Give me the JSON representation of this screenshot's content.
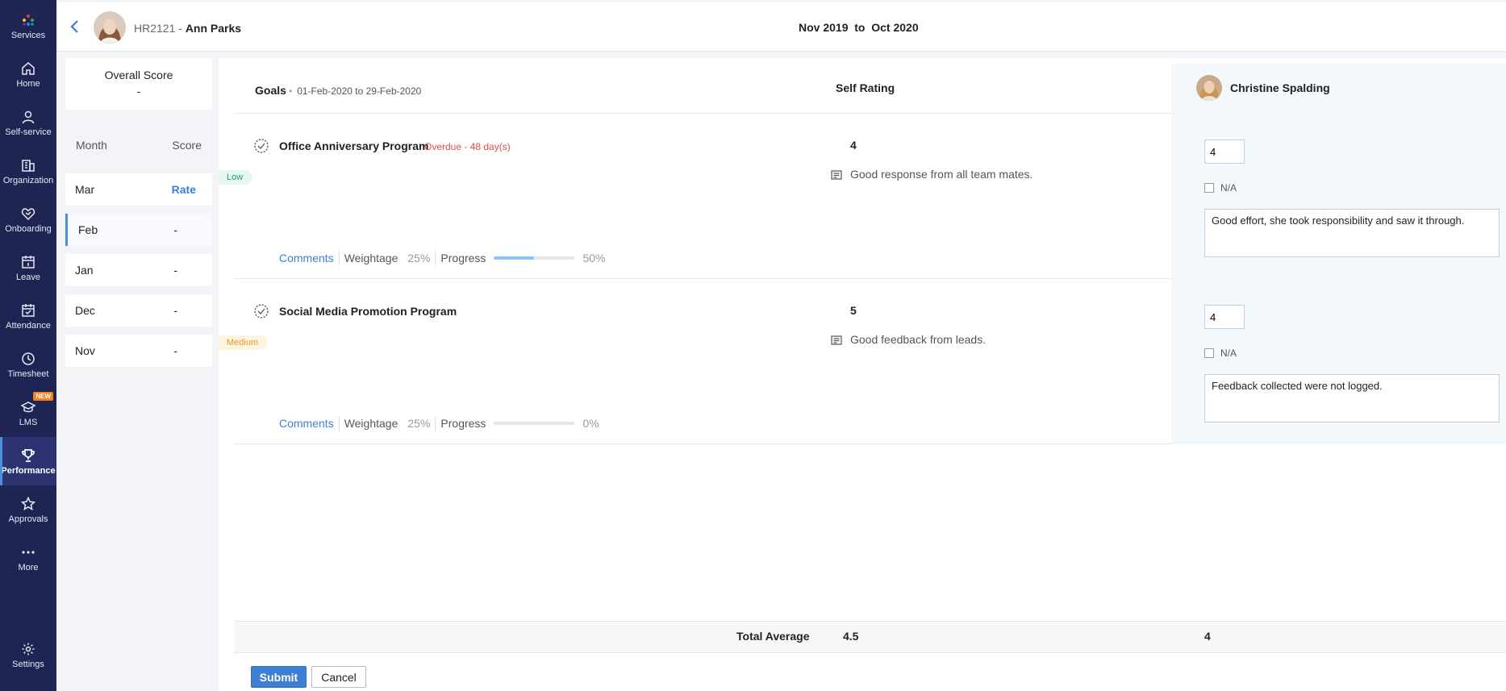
{
  "sidebar": {
    "items": [
      {
        "label": "Services",
        "icon": "services-grid-icon"
      },
      {
        "label": "Home",
        "icon": "home-icon"
      },
      {
        "label": "Self-service",
        "icon": "person-icon"
      },
      {
        "label": "Organization",
        "icon": "building-icon"
      },
      {
        "label": "Onboarding",
        "icon": "handshake-icon"
      },
      {
        "label": "Leave",
        "icon": "calendar-icon"
      },
      {
        "label": "Attendance",
        "icon": "calendar-check-icon"
      },
      {
        "label": "Timesheet",
        "icon": "clock-icon"
      },
      {
        "label": "LMS",
        "icon": "graduation-cap-icon",
        "badge": "NEW"
      },
      {
        "label": "Performance",
        "icon": "trophy-icon",
        "active": true
      },
      {
        "label": "Approvals",
        "icon": "star-icon"
      },
      {
        "label": "More",
        "icon": "more-dots-icon"
      },
      {
        "label": "Settings",
        "icon": "gear-icon"
      }
    ]
  },
  "header": {
    "employee_id": "HR2121 -",
    "employee_name": "Ann Parks",
    "period": "Nov 2019  to  Oct 2020"
  },
  "score_panel": {
    "title": "Overall Score",
    "value": "-",
    "month_label": "Month",
    "score_label": "Score",
    "months": [
      {
        "month": "Mar",
        "score": "Rate"
      },
      {
        "month": "Feb",
        "score": "-"
      },
      {
        "month": "Jan",
        "score": "-"
      },
      {
        "month": "Dec",
        "score": "-"
      },
      {
        "month": "Nov",
        "score": "-"
      }
    ]
  },
  "goals_header": {
    "title": "Goals",
    "date_range": "01-Feb-2020 to 29-Feb-2020",
    "self_rating_label": "Self Rating",
    "reviewer_name": "Christine Spalding"
  },
  "goals": [
    {
      "title": "Office Anniversary Program",
      "overdue": "Overdue - 48 day(s)",
      "priority": "Low",
      "comments_label": "Comments",
      "weightage_label": "Weightage",
      "weightage": "25%",
      "progress_label": "Progress",
      "progress_text": "50%",
      "progress": 0.5,
      "self_rating": "4",
      "self_comment": "Good response from all team mates.",
      "reviewer_rating": "4",
      "na_label": "N/A",
      "reviewer_comment": "Good effort, she took responsibility and saw it through."
    },
    {
      "title": "Social Media Promotion Program",
      "overdue": "",
      "priority": "Medium",
      "comments_label": "Comments",
      "weightage_label": "Weightage",
      "weightage": "25%",
      "progress_label": "Progress",
      "progress_text": "0%",
      "progress": 0,
      "self_rating": "5",
      "self_comment": "Good feedback from leads.",
      "reviewer_rating": "4",
      "na_label": "N/A",
      "reviewer_comment": "Feedback collected were not logged."
    }
  ],
  "totals": {
    "label": "Total Average",
    "self": "4.5",
    "reviewer": "4"
  },
  "actions": {
    "submit": "Submit",
    "cancel": "Cancel"
  },
  "colors": {
    "sidebar_bg": "#1f2553",
    "accent": "#3d7fd3",
    "overdue": "#e04b4b",
    "low": "#22a37a",
    "medium": "#e89a1e"
  }
}
